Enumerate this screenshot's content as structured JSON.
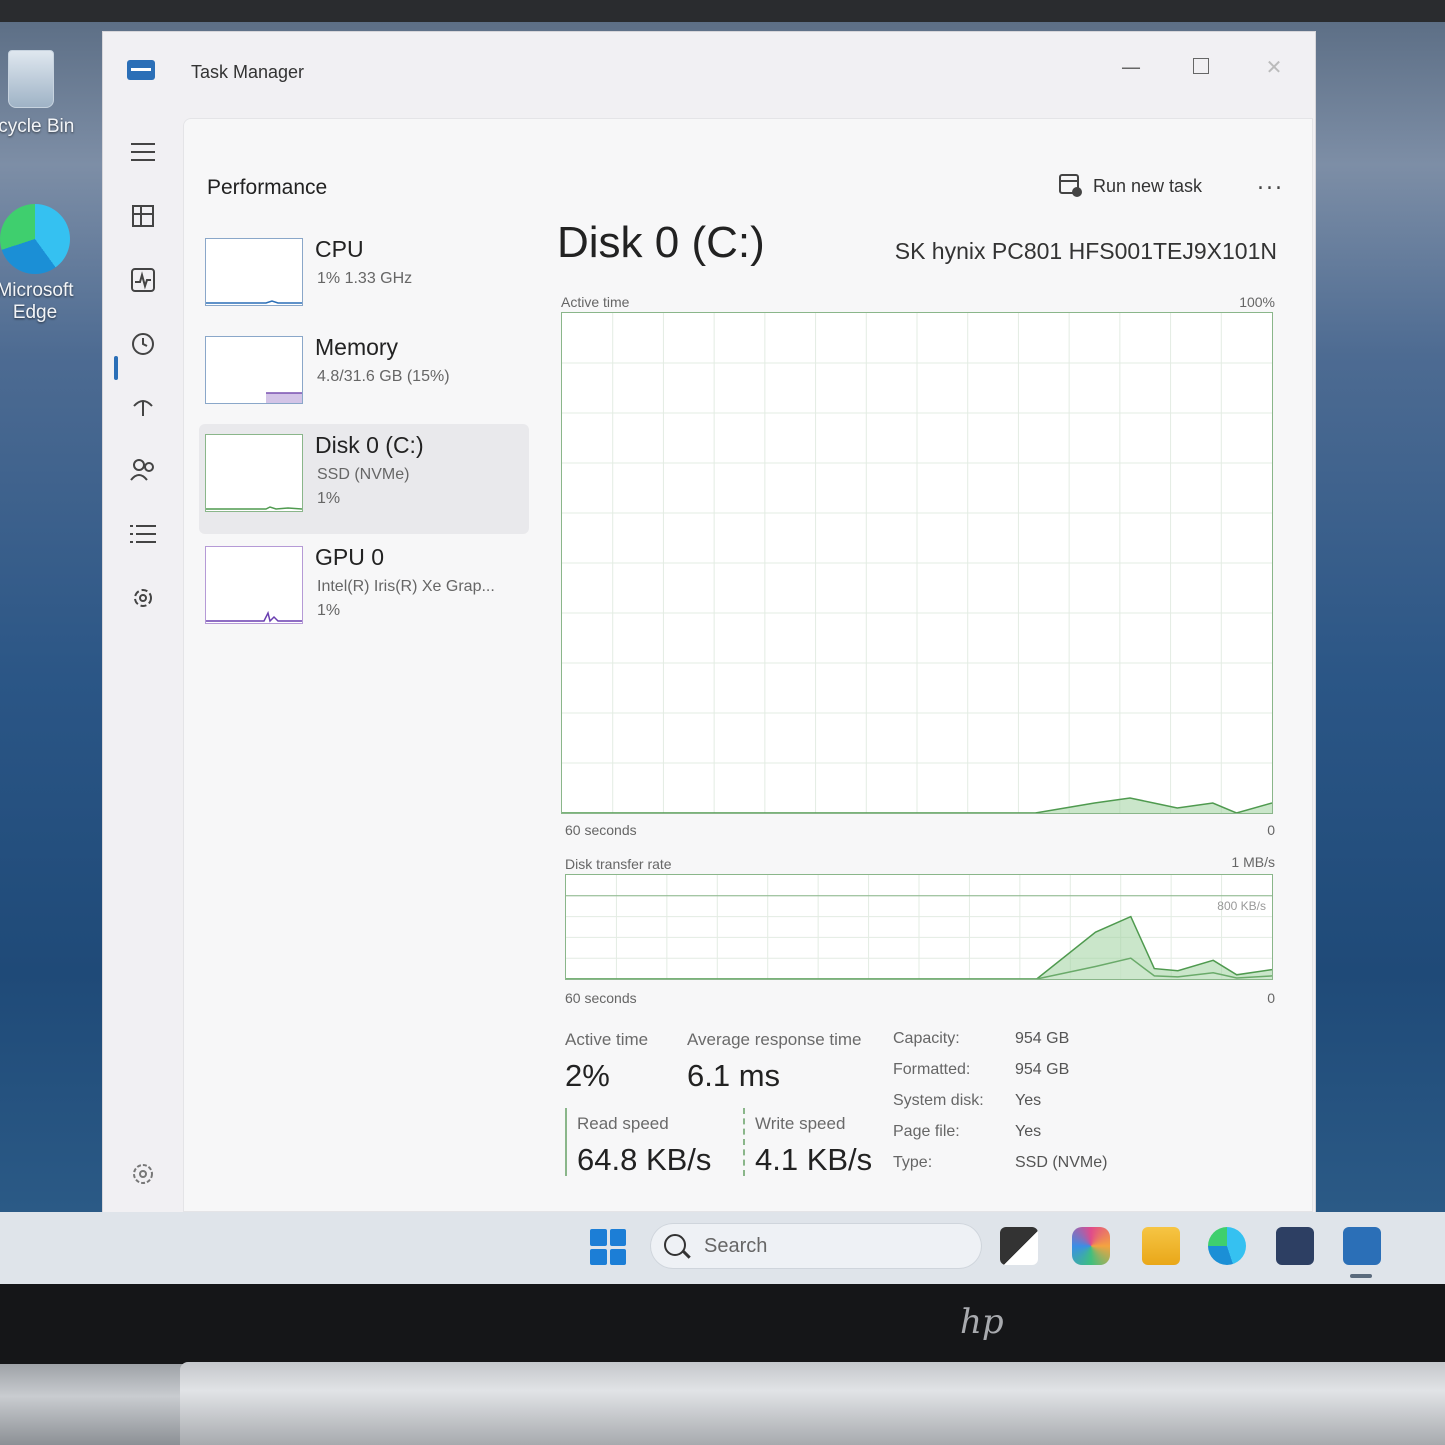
{
  "desktop": {
    "icons": [
      {
        "label": "ecycle Bin",
        "icon": "recycle-bin-icon"
      },
      {
        "label": "Microsoft Edge",
        "icon": "edge-icon"
      }
    ]
  },
  "window": {
    "title": "Task Manager",
    "controls": {
      "minimize": "—",
      "close": "✕"
    }
  },
  "nav": {
    "items": [
      "hamburger-menu-icon",
      "processes-icon",
      "performance-icon",
      "app-history-icon",
      "startup-apps-icon",
      "users-icon",
      "details-icon",
      "services-icon",
      "settings-icon"
    ],
    "active": "performance-icon"
  },
  "header": {
    "page_title": "Performance",
    "run_new_task": "Run new task",
    "more": "..."
  },
  "devices": [
    {
      "name": "CPU",
      "line1": "1% 1.33 GHz",
      "line2": "",
      "color": "#2b6fb7"
    },
    {
      "name": "Memory",
      "line1": "4.8/31.6 GB (15%)",
      "line2": "",
      "color": "#7a52b0"
    },
    {
      "name": "Disk 0 (C:)",
      "line1": "SSD (NVMe)",
      "line2": "1%",
      "color": "#4f9a4f"
    },
    {
      "name": "GPU 0",
      "line1": "Intel(R) Iris(R) Xe Grap...",
      "line2": "1%",
      "color": "#6a3fb0"
    }
  ],
  "selected_device": "Disk 0 (C:)",
  "detail": {
    "title": "Disk 0 (C:)",
    "model": "SK hynix PC801 HFS001TEJ9X101N",
    "active_graph": {
      "label": "Active time",
      "max": "100%",
      "left": "60 seconds",
      "right": "0"
    },
    "transfer_graph": {
      "label": "Disk transfer rate",
      "max": "1 MB/s",
      "mid": "800 KB/s",
      "left": "60 seconds",
      "right": "0"
    },
    "stats": {
      "active_time_label": "Active time",
      "active_time_value": "2%",
      "avg_response_label": "Average response time",
      "avg_response_value": "6.1 ms",
      "read_label": "Read speed",
      "read_value": "64.8 KB/s",
      "write_label": "Write speed",
      "write_value": "4.1 KB/s"
    },
    "specs": [
      {
        "key": "Capacity:",
        "value": "954 GB"
      },
      {
        "key": "Formatted:",
        "value": "954 GB"
      },
      {
        "key": "System disk:",
        "value": "Yes"
      },
      {
        "key": "Page file:",
        "value": "Yes"
      },
      {
        "key": "Type:",
        "value": "SSD (NVMe)"
      }
    ]
  },
  "chart_data": [
    {
      "type": "area",
      "title": "Active time",
      "x": [
        60,
        55,
        50,
        45,
        40,
        35,
        30,
        25,
        20,
        15,
        12,
        10,
        8,
        5,
        3,
        0
      ],
      "values": [
        0,
        0,
        0,
        0,
        0,
        0,
        0,
        0,
        0,
        2,
        3,
        2,
        1,
        2,
        0,
        2
      ],
      "ylim": [
        0,
        100
      ],
      "grid": true
    },
    {
      "type": "area",
      "title": "Disk transfer rate",
      "series": [
        {
          "name": "Read speed",
          "values": [
            0,
            0,
            0,
            0,
            0,
            0,
            0,
            0,
            0,
            450,
            600,
            100,
            80,
            180,
            40,
            90
          ]
        },
        {
          "name": "Write speed",
          "values": [
            0,
            0,
            0,
            0,
            0,
            0,
            0,
            0,
            0,
            120,
            200,
            30,
            20,
            60,
            10,
            30
          ]
        }
      ],
      "x": [
        60,
        55,
        50,
        45,
        40,
        35,
        30,
        25,
        20,
        15,
        12,
        10,
        8,
        5,
        3,
        0
      ],
      "ylim": [
        0,
        1000
      ],
      "grid": true
    }
  ],
  "taskbar": {
    "search_placeholder": "Search",
    "apps": [
      "file-explorer-icon",
      "copilot-icon",
      "folder-icon",
      "edge-icon",
      "store-icon",
      "task-manager-icon"
    ]
  },
  "brand": {
    "logo": "hp"
  },
  "colors": {
    "accent": "#2b6fb7",
    "disk_green": "#4f9a4f"
  }
}
